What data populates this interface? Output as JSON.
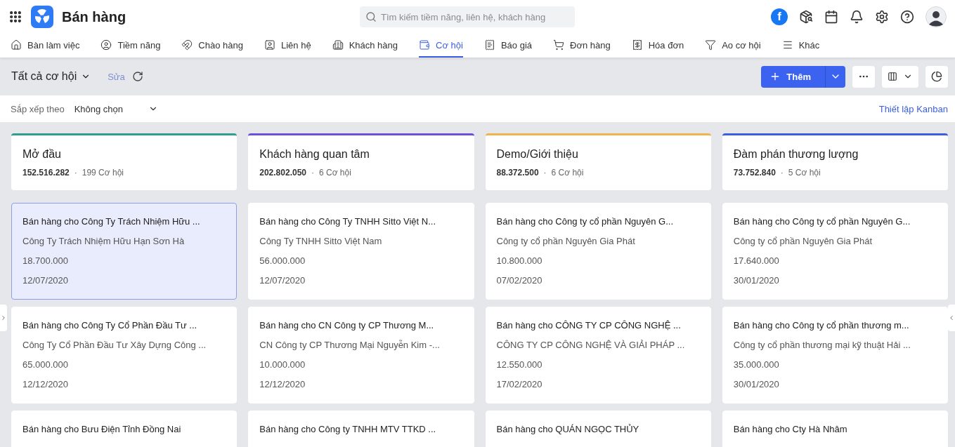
{
  "app": {
    "title": "Bán hàng"
  },
  "search": {
    "placeholder": "Tìm kiếm tiềm năng, liên hệ, khách hàng"
  },
  "header_badge": "f",
  "nav_tabs": [
    {
      "label": "Bàn làm việc",
      "selected": false
    },
    {
      "label": "Tiềm năng",
      "selected": false
    },
    {
      "label": "Chào hàng",
      "selected": false
    },
    {
      "label": "Liên hệ",
      "selected": false
    },
    {
      "label": "Khách hàng",
      "selected": false
    },
    {
      "label": "Cơ hội",
      "selected": true
    },
    {
      "label": "Báo giá",
      "selected": false
    },
    {
      "label": "Đơn hàng",
      "selected": false
    },
    {
      "label": "Hóa đơn",
      "selected": false
    },
    {
      "label": "Ao cơ hội",
      "selected": false
    },
    {
      "label": "Khác",
      "selected": false
    }
  ],
  "toolbar": {
    "view_label": "Tất cả cơ hội",
    "edit_label": "Sửa",
    "edit_disabled": true,
    "add_label": "Thêm"
  },
  "sort": {
    "label": "Sắp xếp theo",
    "value": "Không chọn"
  },
  "kanban_settings_link": "Thiết lập Kanban",
  "columns": [
    {
      "title": "Mở đầu",
      "color": "#2e9e8f",
      "amount": "152.516.282",
      "separator": "·",
      "count": "199 Cơ hội",
      "cards": [
        {
          "title": "Bán hàng cho Công Ty Trách Nhiệm Hữu ...",
          "company": "Công Ty Trách Nhiệm Hữu Hạn Sơn Hà",
          "amount": "18.700.000",
          "date": "12/07/2020",
          "selected": true
        },
        {
          "title": "Bán hàng cho Công Ty Cổ Phần Đầu Tư ...",
          "company": "Công Ty Cổ Phần Đầu Tư Xây Dựng Công ...",
          "amount": "65.000.000",
          "date": "12/12/2020",
          "selected": false
        },
        {
          "title": "Bán hàng cho Bưu Điện Tỉnh Đồng Nai",
          "selected": false
        }
      ]
    },
    {
      "title": "Khách hàng quan tâm",
      "color": "#6c4fdc",
      "amount": "202.802.050",
      "separator": "·",
      "count": "6 Cơ hội",
      "cards": [
        {
          "title": "Bán hàng cho Công Ty TNHH Sitto Việt N...",
          "company": "Công Ty TNHH Sitto Việt Nam",
          "amount": "56.000.000",
          "date": "12/07/2020",
          "selected": false
        },
        {
          "title": "Bán hàng cho CN Công ty CP Thương M...",
          "company": "CN Công ty CP Thương Mại Nguyễn Kim -...",
          "amount": "10.000.000",
          "date": "12/12/2020",
          "selected": false
        },
        {
          "title": "Bán hàng cho Công ty TNHH MTV TTKD ...",
          "selected": false
        }
      ]
    },
    {
      "title": "Demo/Giới thiệu",
      "color": "#f0b24a",
      "amount": "88.372.500",
      "separator": "·",
      "count": "6 Cơ hội",
      "cards": [
        {
          "title": "Bán hàng cho Công ty cổ phần Nguyên G...",
          "company": "Công ty cổ phần Nguyên Gia Phát",
          "amount": "10.800.000",
          "date": "07/02/2020",
          "selected": false
        },
        {
          "title": "Bán hàng cho CÔNG TY CP CÔNG NGHỆ ...",
          "company": "CÔNG TY CP CÔNG NGHỆ VÀ GIẢI PHÁP ...",
          "amount": "12.550.000",
          "date": "17/02/2020",
          "selected": false
        },
        {
          "title": "Bán hàng cho QUÁN NGỌC THỦY",
          "selected": false
        }
      ]
    },
    {
      "title": "Đàm phán thương lượng",
      "color": "#3b5fe0",
      "amount": "73.752.840",
      "separator": "·",
      "count": "5 Cơ hội",
      "cards": [
        {
          "title": "Bán hàng cho Công ty cổ phần Nguyên G...",
          "company": "Công ty cổ phần Nguyên Gia Phát",
          "amount": "17.640.000",
          "date": "30/01/2020",
          "selected": false
        },
        {
          "title": "Bán hàng cho Công ty cổ phần thương m...",
          "company": "Công ty cổ phần thương mại kỹ thuật Hải ...",
          "amount": "35.000.000",
          "date": "30/01/2020",
          "selected": false
        },
        {
          "title": "Bán hàng cho Cty Hà Nhâm",
          "selected": false
        }
      ]
    }
  ]
}
